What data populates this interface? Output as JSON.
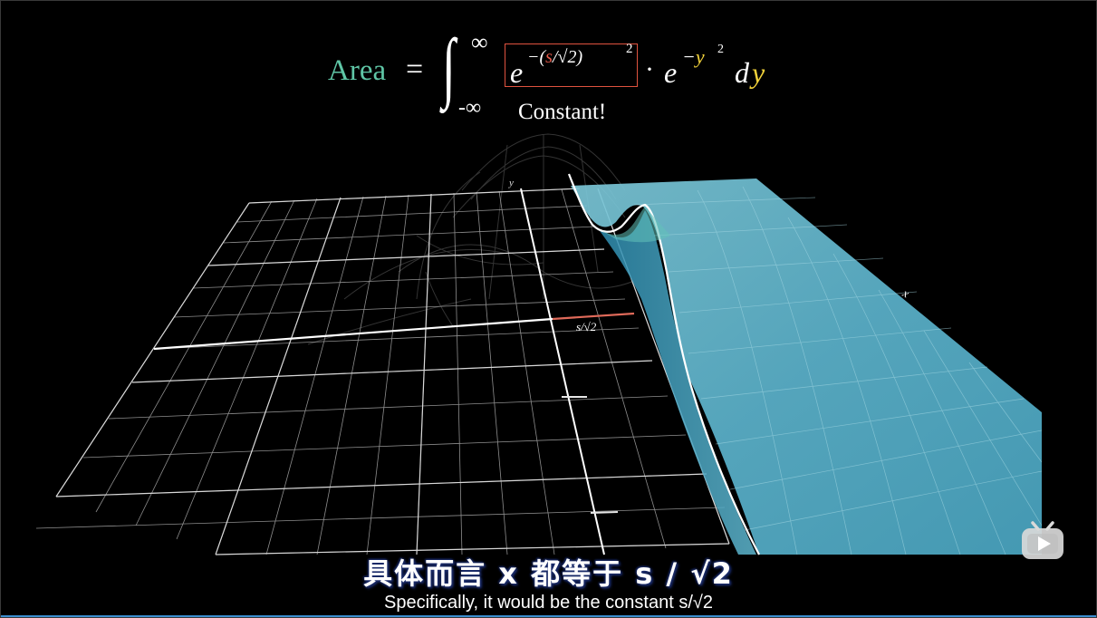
{
  "equation": {
    "area_label": "Area",
    "equals": "=",
    "integral_sign": "∫",
    "upper_limit": "∞",
    "lower_limit": "-∞",
    "boxed_base": "e",
    "boxed_exp_minus_paren": "−(",
    "boxed_exp_s": "s",
    "boxed_exp_rest": "/√2)",
    "boxed_exp_square": "2",
    "dot": "·",
    "second_base": "e",
    "second_exp_minus": "−",
    "second_exp_y": "y",
    "second_exp_square": "2",
    "differential_d": "d",
    "differential_y": "y",
    "annotation": "Constant!"
  },
  "axis_labels": {
    "y_axis": "y",
    "x_axis": "x",
    "cut_position": "s/√2"
  },
  "subtitles": {
    "chinese": "具体而言  x 都等于 s / √2",
    "english": "Specifically, it would be the constant s/√2"
  },
  "watermark": {
    "icon": "bilibili-tv-icon"
  },
  "colors": {
    "background": "#000000",
    "area_text": "#5fc6a6",
    "highlight_box": "#e0533f",
    "s_variable": "#e85a4a",
    "y_variable": "#f2d23a",
    "surface_fill": "#5bb7cf",
    "progress_bar": "#3b8ed0"
  }
}
